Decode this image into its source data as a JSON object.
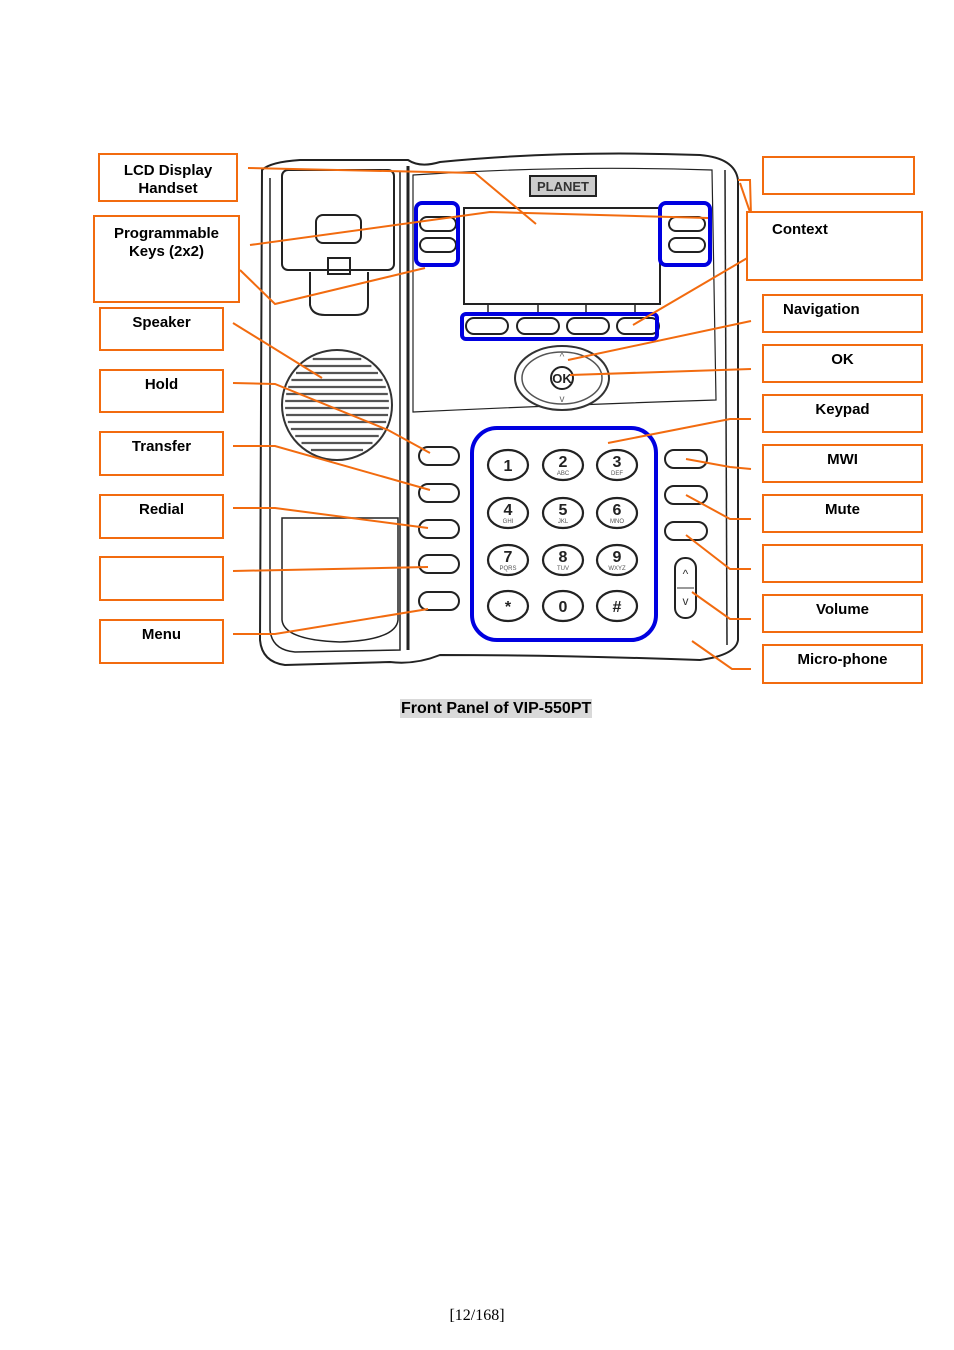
{
  "figure": {
    "caption": "Front Panel of VIP-550PT",
    "brand_logo": "PLANET",
    "page_number": "[12/168]",
    "colors": {
      "callout": "#f26b0f",
      "highlight": "#0000e0",
      "outline": "#222222"
    }
  },
  "labels_left": [
    {
      "id": "lcd-display-handset",
      "line1": "LCD Display",
      "line2": "Handset"
    },
    {
      "id": "programmable-keys",
      "line1": "Programmable",
      "line2": "Keys (2x2)"
    },
    {
      "id": "speaker",
      "line1": "Speaker",
      "line2": ""
    },
    {
      "id": "hold",
      "line1": "Hold",
      "line2": ""
    },
    {
      "id": "transfer",
      "line1": "Transfer",
      "line2": ""
    },
    {
      "id": "redial",
      "line1": "Redial",
      "line2": ""
    },
    {
      "id": "blank-left",
      "line1": "",
      "line2": ""
    },
    {
      "id": "menu",
      "line1": "Menu",
      "line2": ""
    }
  ],
  "labels_right": [
    {
      "id": "blank-top-right",
      "line1": ""
    },
    {
      "id": "context",
      "line1": "Context"
    },
    {
      "id": "navigation",
      "line1": "Navigation"
    },
    {
      "id": "ok",
      "line1": "OK"
    },
    {
      "id": "keypad",
      "line1": "Keypad"
    },
    {
      "id": "mwi",
      "line1": "MWI"
    },
    {
      "id": "mute",
      "line1": "Mute"
    },
    {
      "id": "blank-right",
      "line1": ""
    },
    {
      "id": "volume",
      "line1": "Volume"
    },
    {
      "id": "microphone",
      "line1": "Micro-phone"
    }
  ],
  "keypad": {
    "keys": [
      {
        "digit": "1",
        "letters": ""
      },
      {
        "digit": "2",
        "letters": "ABC"
      },
      {
        "digit": "3",
        "letters": "DEF"
      },
      {
        "digit": "4",
        "letters": "GHI"
      },
      {
        "digit": "5",
        "letters": "JKL"
      },
      {
        "digit": "6",
        "letters": "MNO"
      },
      {
        "digit": "7",
        "letters": "PQRS"
      },
      {
        "digit": "8",
        "letters": "TUV"
      },
      {
        "digit": "9",
        "letters": "WXYZ"
      },
      {
        "digit": "*",
        "letters": ""
      },
      {
        "digit": "0",
        "letters": ""
      },
      {
        "digit": "#",
        "letters": ""
      }
    ]
  },
  "nav": {
    "ok_label": "OK",
    "up_icon": "^",
    "down_icon": "v"
  },
  "volume": {
    "up_icon": "^",
    "down_icon": "v"
  }
}
